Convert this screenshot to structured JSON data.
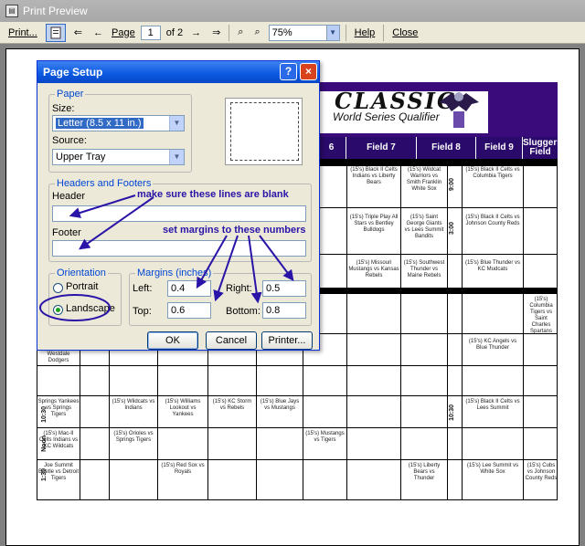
{
  "window": {
    "title": "Print Preview"
  },
  "toolbar": {
    "print_label": "Print...",
    "page_label": "Page",
    "page_value": "1",
    "page_of": "of 2",
    "zoom_value": "75%",
    "help_label": "Help",
    "close_label": "Close"
  },
  "dialog": {
    "title": "Page Setup",
    "help_glyph": "?",
    "close_glyph": "×",
    "paper": {
      "group_label": "Paper",
      "size_label": "Size:",
      "size_value": "Letter (8.5 x 11 in.)",
      "source_label": "Source:",
      "source_value": "Upper Tray"
    },
    "headers_footers": {
      "group_label": "Headers and Footers",
      "header_label": "Header",
      "header_value": "",
      "footer_label": "Footer",
      "footer_value": ""
    },
    "orientation": {
      "group_label": "Orientation",
      "portrait_label": "Portrait",
      "landscape_label": "Landscape",
      "selected": "Landscape"
    },
    "margins": {
      "group_label": "Margins (inches)",
      "left_label": "Left:",
      "left_value": "0.4",
      "right_label": "Right:",
      "right_value": "0.5",
      "top_label": "Top:",
      "top_value": "0.6",
      "bottom_label": "Bottom:",
      "bottom_value": "0.8"
    },
    "buttons": {
      "ok": "OK",
      "cancel": "Cancel",
      "printer": "Printer..."
    }
  },
  "annotations": {
    "blank_note": "make sure these lines are blank",
    "margin_note": "set margins to these numbers",
    "color": "#2a14a8"
  },
  "preview": {
    "banner_title": "CLASSIC",
    "banner_subtitle": "World Series Qualifier",
    "headers": [
      "6",
      "Field 7",
      "Field 8",
      "Field 9",
      "Sluggers Field"
    ],
    "times": [
      "9:00",
      "3:00",
      "10:30",
      "Noon",
      "1:30"
    ],
    "left_cells": [
      "Springs Yankees vs Springs Tigers",
      "Joe Summit Red Ride vs Westdale Dodgers",
      "(15's) Mac-II Celts Indians vs KC Wildcats",
      "Joe Summit Beetle vs Detroit Tigers"
    ],
    "sample_cells": [
      "(15's) Black II Celts Indians vs Liberty Bears",
      "(15's) Wildcat Warriors vs Smith Franklin White Sox",
      "(15's) Triple Play All Stars vs Bentley Bulldogs",
      "(15's) Saint George Giants vs Lees Summit Bandits",
      "(15's) Missouri Mustangs vs Kansas Rebels",
      "(15's) Southwest Thunder vs Maine Rebels",
      "(15's) Black II Celts vs Columbia Tigers",
      "(15's) Black II Celts vs Johnson County Reds",
      "(15's) Blue Thunder vs KC Mudcats",
      "(15's) Columbia Tigers vs Saint Charles Spartans",
      "(15's) KC Angels vs Blue Thunder",
      "(15's) Orioles vs Springs Tigers",
      "(15's) Wildcats vs Indians",
      "(15's) Williams Lookout vs Yankees",
      "(15's) KC Storm vs Rebels",
      "(15's) Blue Jays vs Mustangs",
      "(15's) Mustangs vs Tigers",
      "(15's) Liberty Bears vs Thunder",
      "(15's) Red Sox vs Royals",
      "(15's) Lee Summit vs White Sox",
      "(15's) Black II Celts vs Lees Summit",
      "(15's) Cubs vs Johnson County Reds"
    ]
  }
}
